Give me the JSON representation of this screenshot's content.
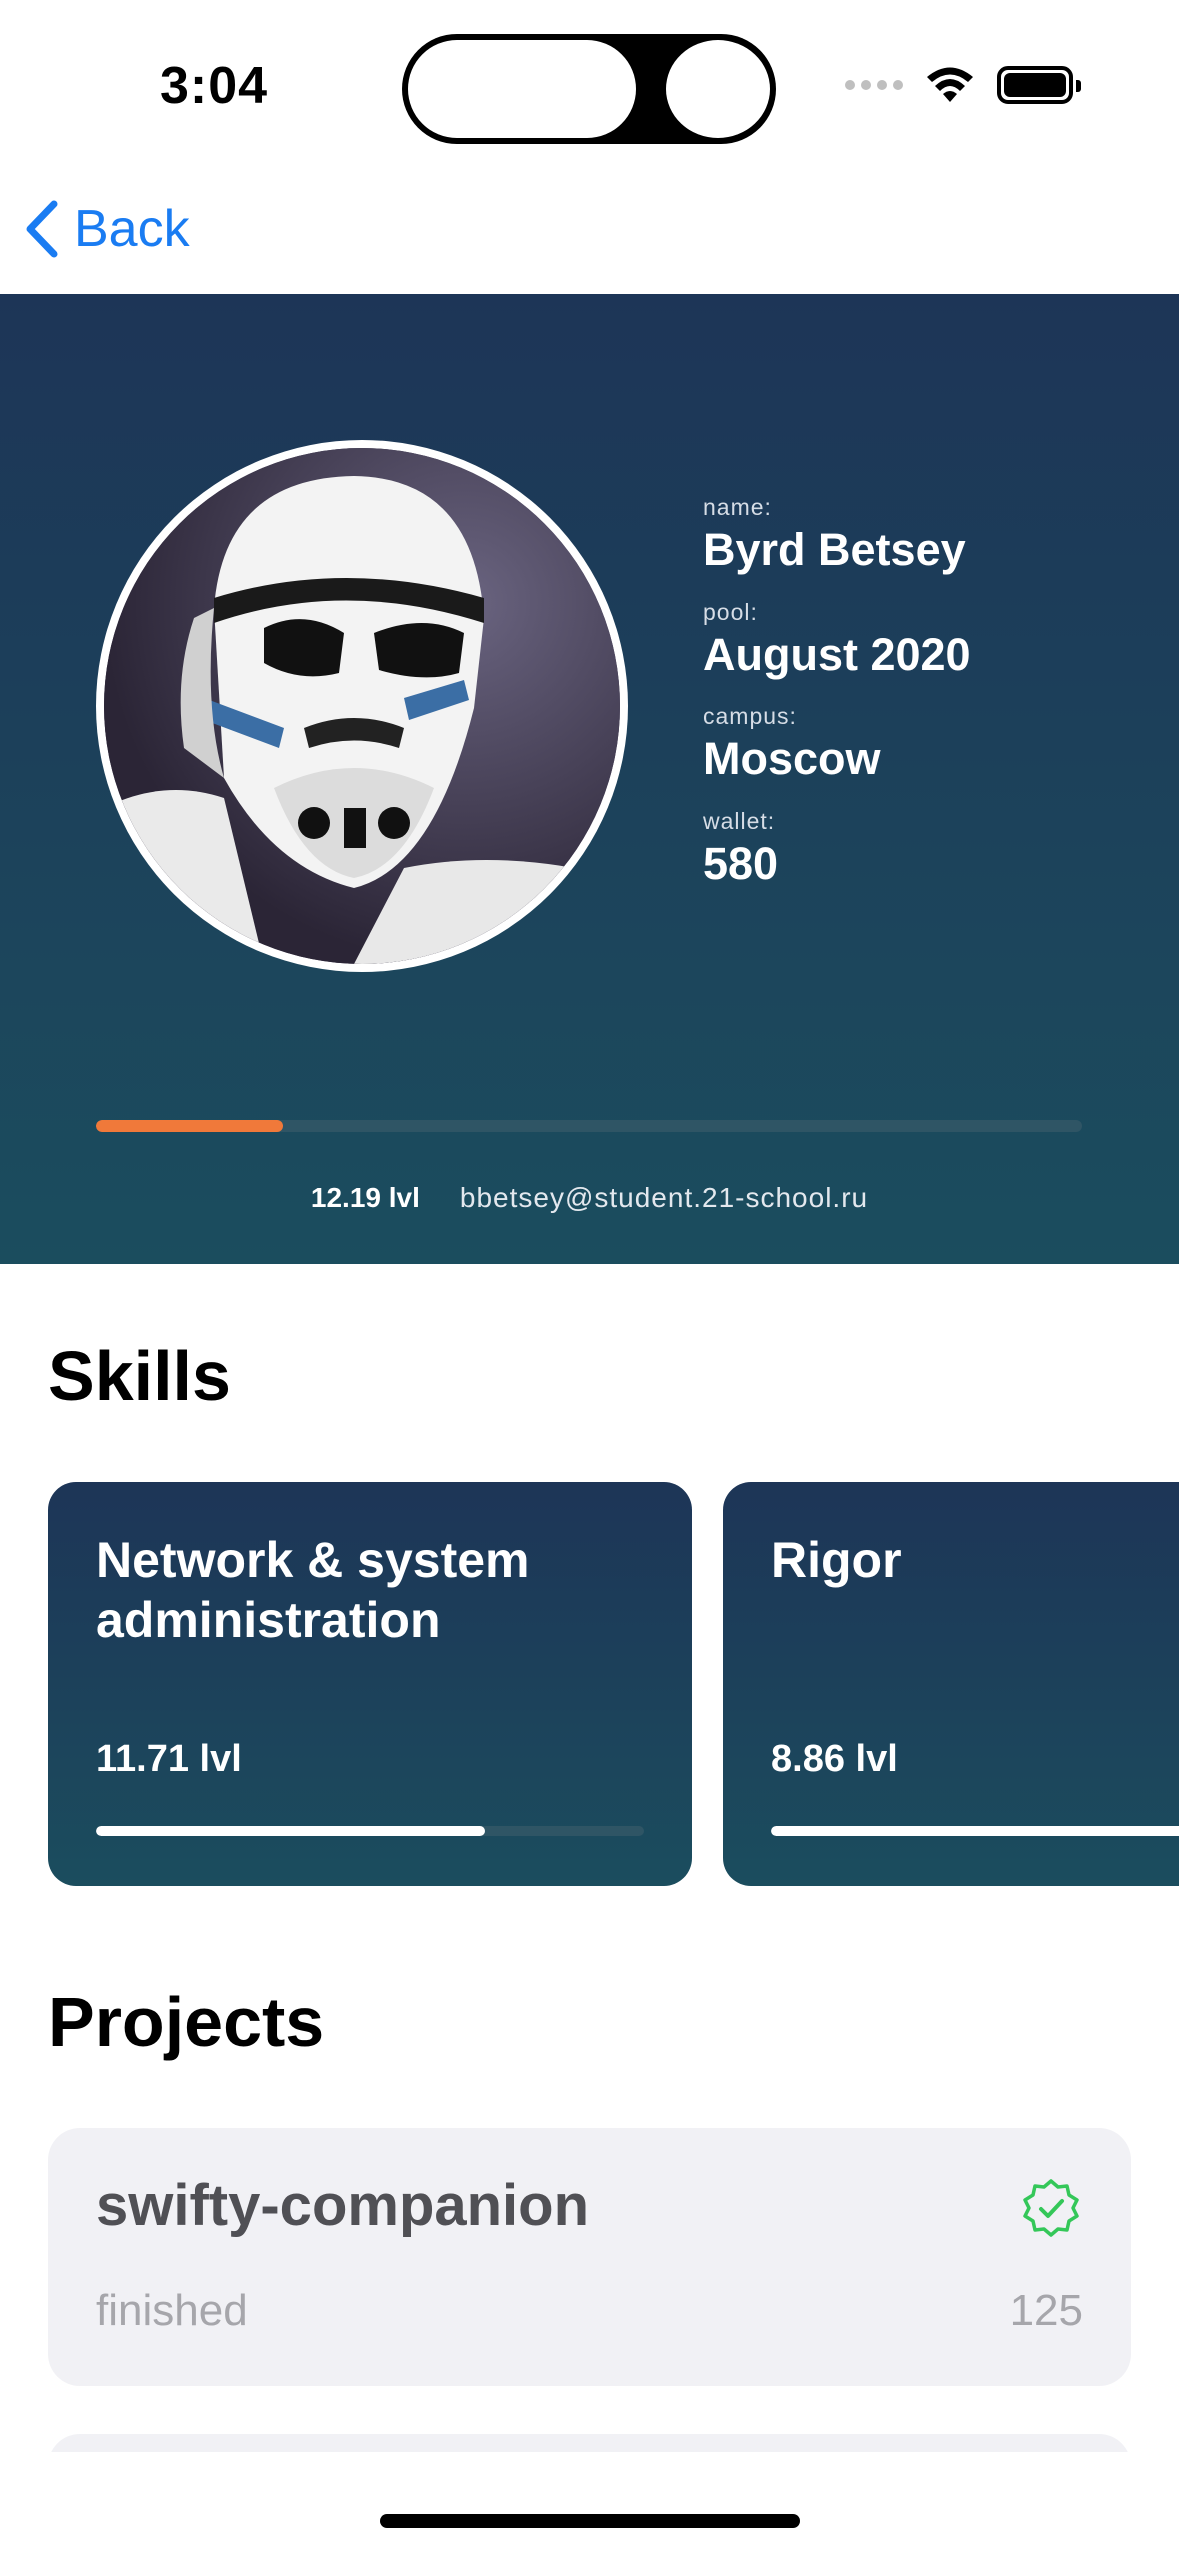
{
  "status_bar": {
    "time": "3:04",
    "icons": [
      "signal-icon",
      "wifi-icon",
      "battery-icon"
    ]
  },
  "nav": {
    "back_label": "Back",
    "accent_color": "#1a7cf2"
  },
  "profile": {
    "labels": {
      "name": "name:",
      "pool": "pool:",
      "campus": "campus:",
      "wallet": "wallet:"
    },
    "name": "Byrd Betsey",
    "pool": "August 2020",
    "campus": "Moscow",
    "wallet": "580",
    "level_text": "12.19 lvl",
    "level_progress": 0.19,
    "email": "bbetsey@student.21-school.ru",
    "progress_color": "#f0793a"
  },
  "skills": {
    "title": "Skills",
    "items": [
      {
        "name": "Network & system administration",
        "level_text": "11.71 lvl",
        "progress": 0.71
      },
      {
        "name": "Rigor",
        "level_text": "8.86 lvl",
        "progress": 0.86
      }
    ]
  },
  "projects": {
    "title": "Projects",
    "items": [
      {
        "name": "swifty-companion",
        "status": "finished",
        "score": "125",
        "verified": true
      }
    ],
    "verified_color": "#34c759"
  }
}
